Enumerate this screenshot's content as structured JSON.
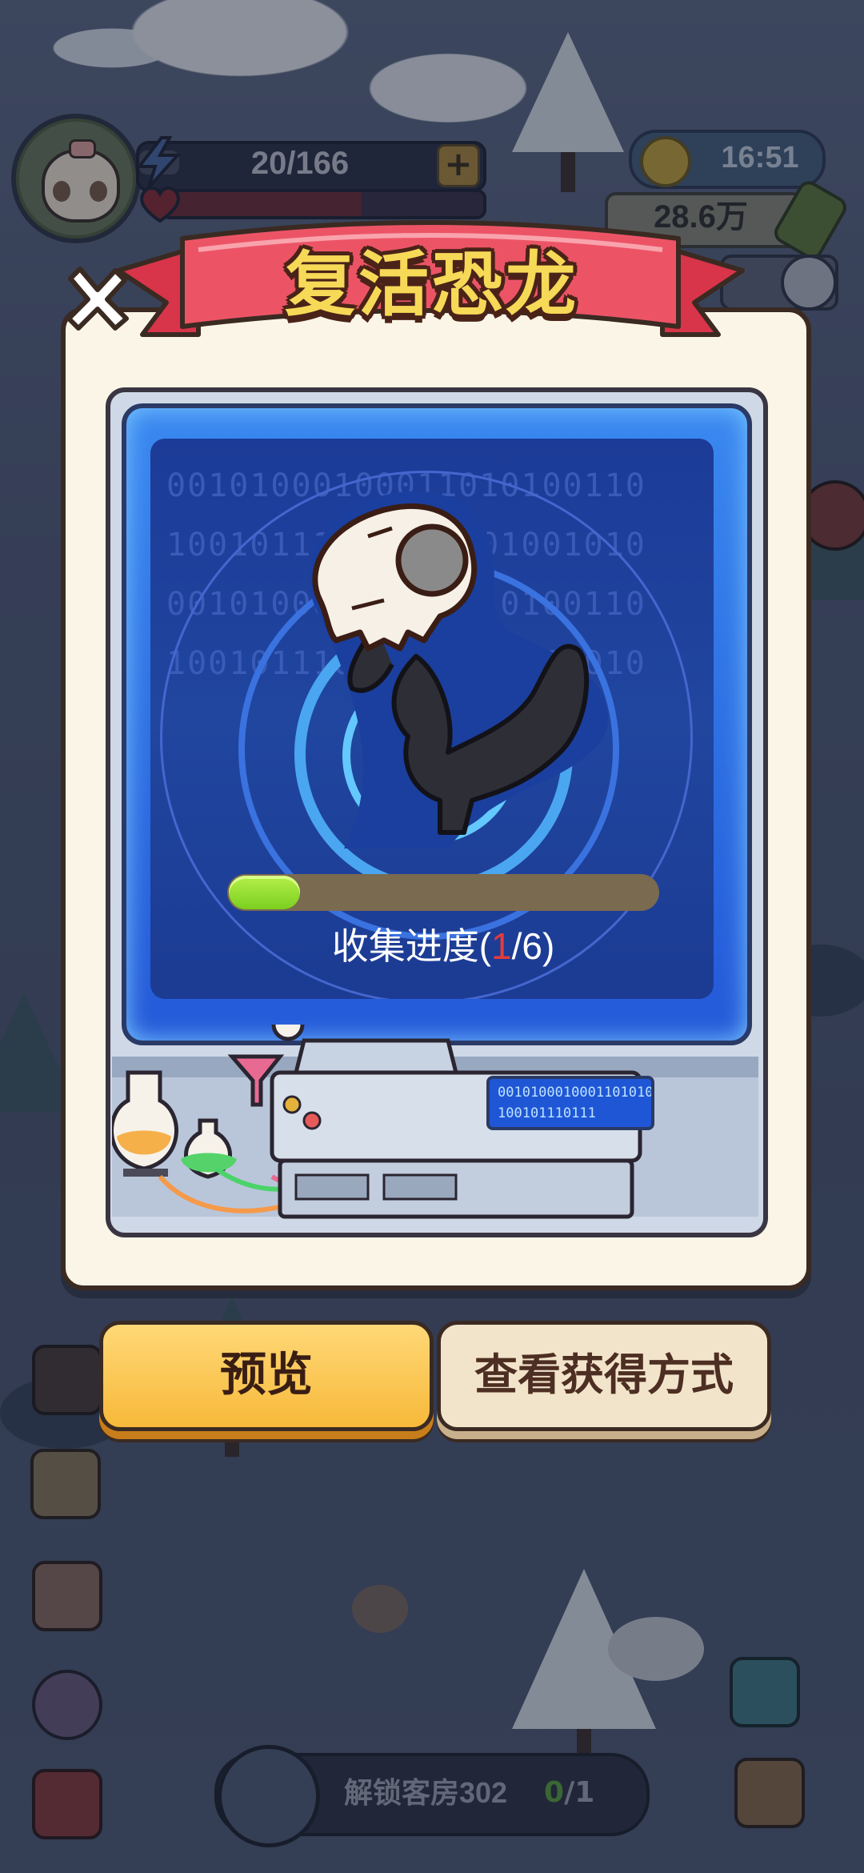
{
  "hud": {
    "energy": "20/166",
    "energy_level": 0.12,
    "heart_level": 0.62,
    "time": "16:51",
    "coins": "28.6万"
  },
  "dialog": {
    "title": "复活恐龙",
    "binary_lines": [
      "00101000100011010100110",
      "10010111011010101001010",
      "00101000100011010100110",
      "10010111011010101001010"
    ],
    "progress": {
      "label_prefix": "收集进度(",
      "current": "1",
      "suffix": "/6)",
      "collected": 1,
      "total": 6
    },
    "console_text": "0010100010001101010 100101110111",
    "buttons": {
      "preview": "预览",
      "obtain": "查看获得方式"
    }
  },
  "quest": {
    "label": "解锁客房302",
    "done": "0",
    "total_suffix": "/1"
  },
  "colors": {
    "title_yellow": "#f7d958",
    "ribbon_red": "#e8455a",
    "screen_blue": "#2459d8",
    "progress_green": "#8bd62a",
    "button_yellow": "#f7b93a"
  }
}
